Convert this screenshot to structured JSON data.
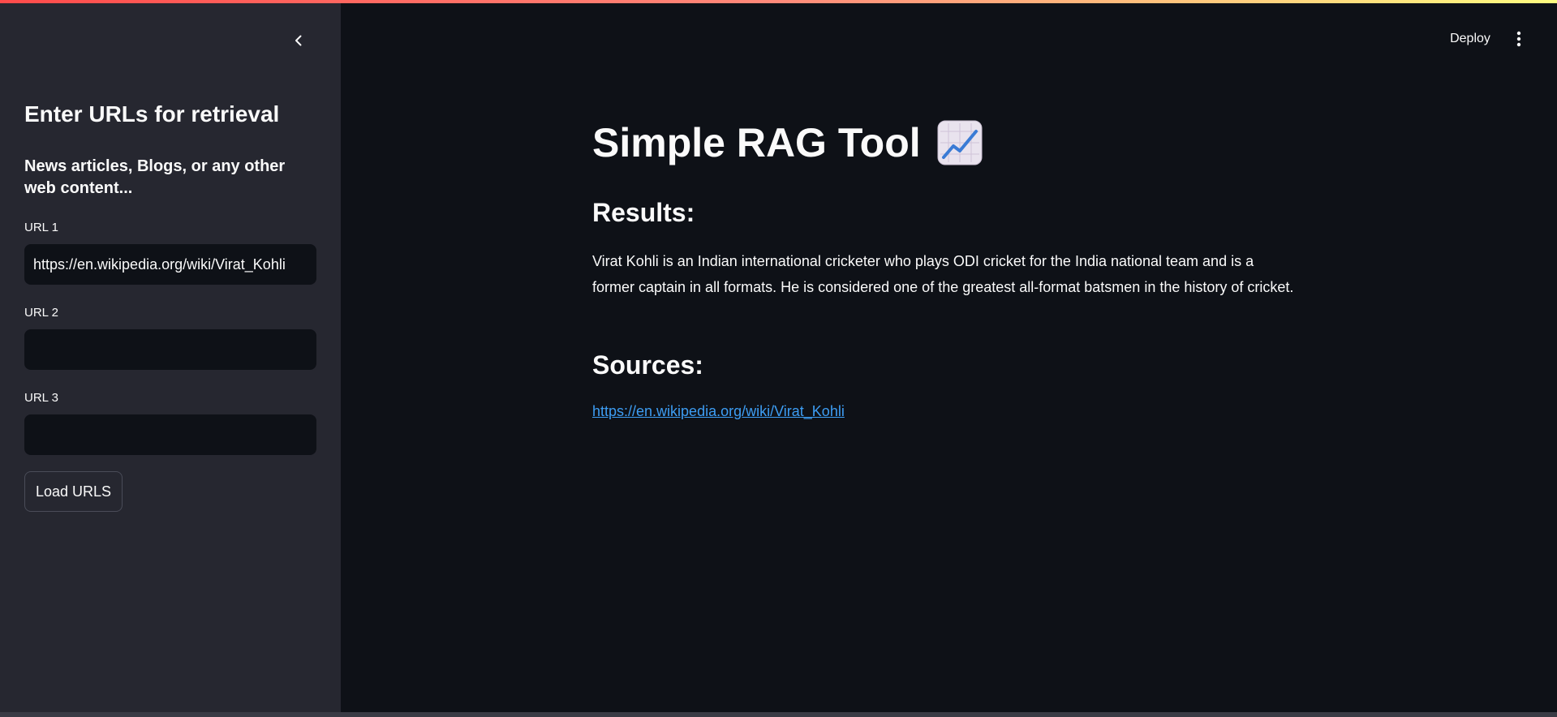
{
  "sidebar": {
    "title": "Enter URLs for retrieval",
    "subtitle": "News articles, Blogs, or any other web content...",
    "fields": [
      {
        "label": "URL 1",
        "value": "https://en.wikipedia.org/wiki/Virat_Kohli"
      },
      {
        "label": "URL 2",
        "value": ""
      },
      {
        "label": "URL 3",
        "value": ""
      }
    ],
    "load_button": "Load URLS",
    "collapse_icon": "chevron-left-icon"
  },
  "header": {
    "deploy_label": "Deploy",
    "menu_icon": "vertical-dots-icon",
    "accent_gradient": [
      "#ff4b4b",
      "#fffd80"
    ]
  },
  "main": {
    "title": "Simple RAG Tool",
    "title_emoji": "chart-increasing-icon",
    "results_heading": "Results:",
    "answer": "Virat Kohli is an Indian international cricketer who plays ODI cricket for the India national team and is a former captain in all formats. He is considered one of the greatest all-format batsmen in the history of cricket.",
    "sources_heading": "Sources:",
    "source_link": "https://en.wikipedia.org/wiki/Virat_Kohli"
  },
  "colors": {
    "background": "#0e1117",
    "sidebar": "#262730",
    "link": "#3d9df3"
  }
}
